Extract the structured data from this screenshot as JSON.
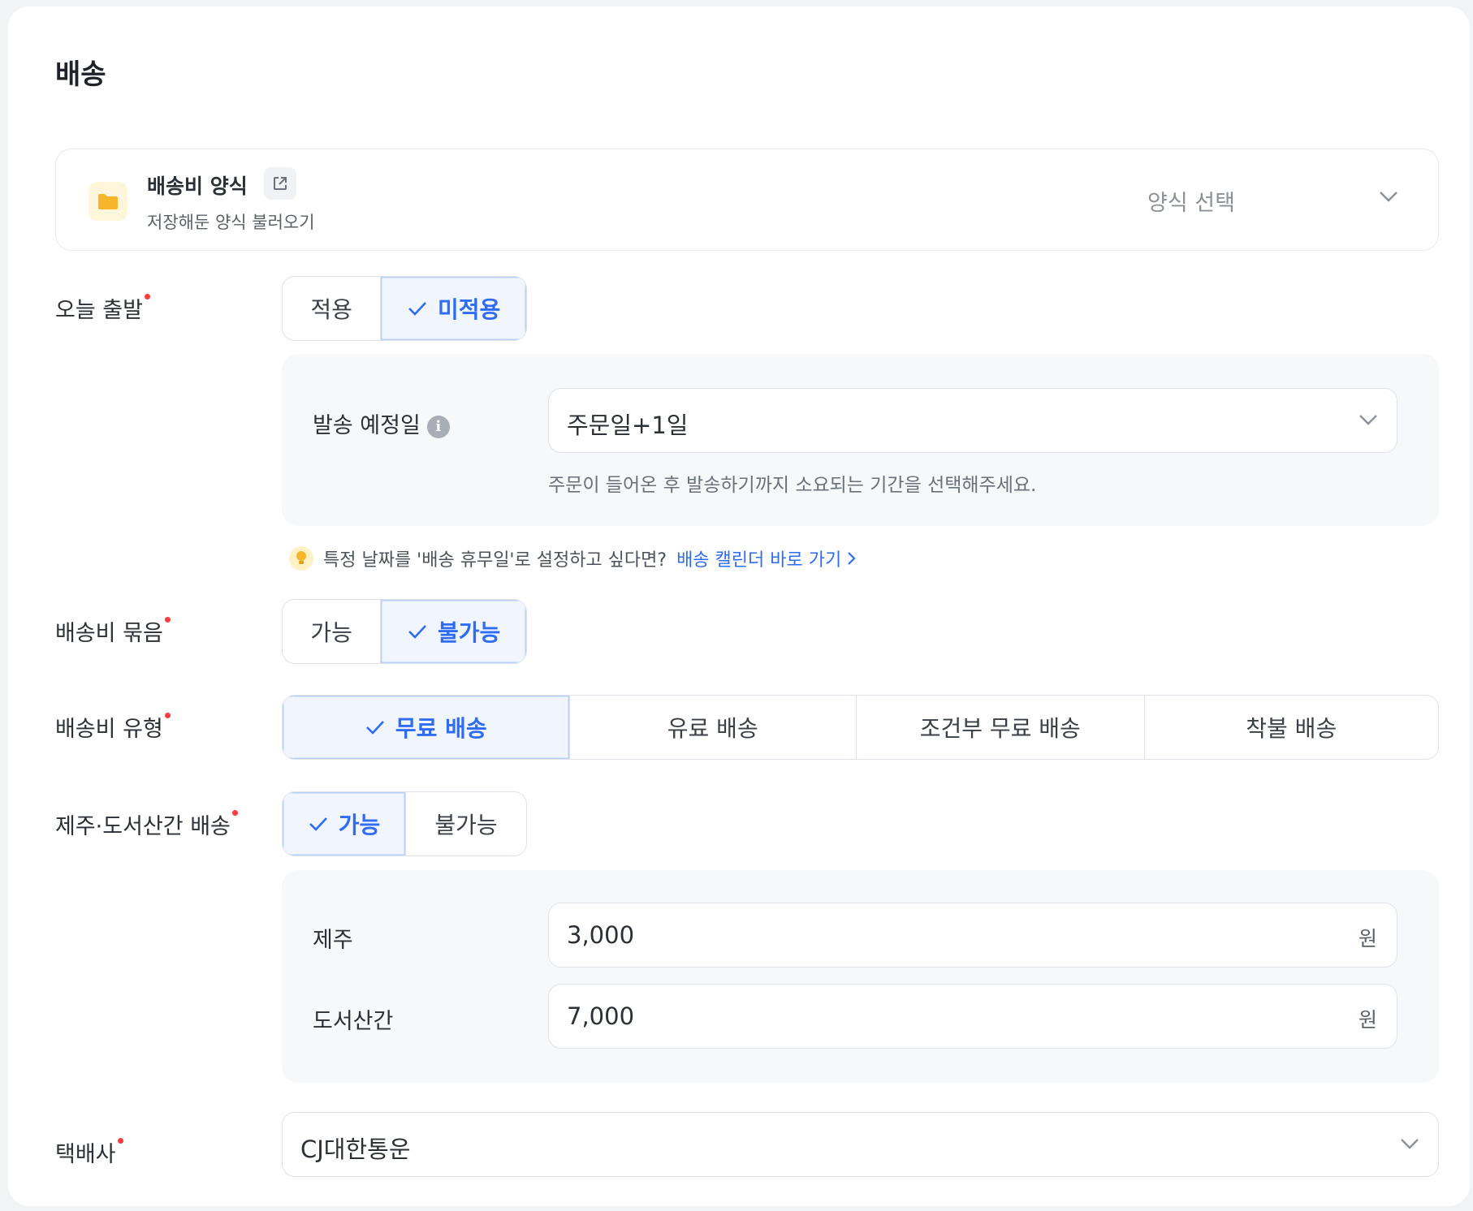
{
  "section": {
    "title": "배송"
  },
  "template": {
    "title": "배송비 양식",
    "subtitle": "저장해둔 양식 불러오기",
    "select_placeholder": "양식 선택"
  },
  "today_departure": {
    "label": "오늘 출발",
    "options": [
      "적용",
      "미적용"
    ],
    "selected": "미적용",
    "ship_date": {
      "label": "발송 예정일",
      "value": "주문일+1일",
      "hint": "주문이 들어온 후 발송하기까지 소요되는 기간을 선택해주세요."
    },
    "tip": {
      "text": "특정 날짜를 '배송 휴무일'로 설정하고 싶다면?",
      "link": "배송 캘린더 바로 가기"
    }
  },
  "bundle": {
    "label": "배송비 묶음",
    "options": [
      "가능",
      "불가능"
    ],
    "selected": "불가능"
  },
  "fee_type": {
    "label": "배송비 유형",
    "options": [
      "무료 배송",
      "유료 배송",
      "조건부 무료 배송",
      "착불 배송"
    ],
    "selected": "무료 배송"
  },
  "island": {
    "label": "제주·도서산간 배송",
    "options": [
      "가능",
      "불가능"
    ],
    "selected": "가능",
    "jeju": {
      "label": "제주",
      "value": "3,000",
      "unit": "원"
    },
    "remote": {
      "label": "도서산간",
      "value": "7,000",
      "unit": "원"
    }
  },
  "courier": {
    "label": "택배사",
    "value": "CJ대한통운"
  },
  "colors": {
    "accent": "#2f6cf6",
    "required": "#ff3b3b",
    "active_bg": "#f1f6fe"
  },
  "icons": [
    "folder-icon",
    "external-link-icon",
    "chevron-down-icon",
    "check-icon",
    "info-icon",
    "lightbulb-icon",
    "chevron-right-icon"
  ]
}
